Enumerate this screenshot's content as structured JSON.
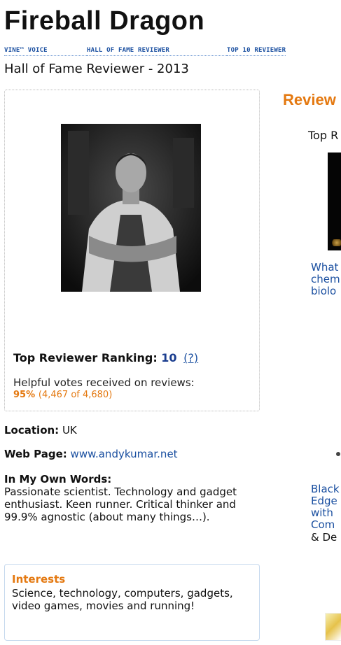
{
  "profile": {
    "name": "Fireball Dragon",
    "badges": [
      "VINE™ VOICE",
      "HALL OF FAME REVIEWER",
      "TOP 10 REVIEWER"
    ],
    "hall_of_fame": "Hall of Fame Reviewer - 2013",
    "ranking_label": "Top Reviewer Ranking:",
    "ranking_value": "10",
    "ranking_help": "(?)",
    "votes_label": "Helpful votes received on reviews:",
    "votes_percent": "95%",
    "votes_detail": "(4,467 of 4,680)",
    "location_label": "Location:",
    "location_value": "UK",
    "webpage_label": "Web Page:",
    "webpage_value": "www.andykumar.net",
    "words_label": "In My Own Words:",
    "words_text": "Passionate scientist. Technology and gadget enthusiast. Keen runner. Critical thinker and 99.9% agnostic (about many things…).",
    "interests_label": "Interests",
    "interests_text": "Science, technology, computers, gadgets, video games, movies and running!"
  },
  "reviews": {
    "heading": "Review",
    "top_label": "Top R",
    "book1_title": "What\nchem\nbiolo",
    "book2_title": "Black\nEdge\nwith\nCom",
    "book2_sub": "& De"
  }
}
